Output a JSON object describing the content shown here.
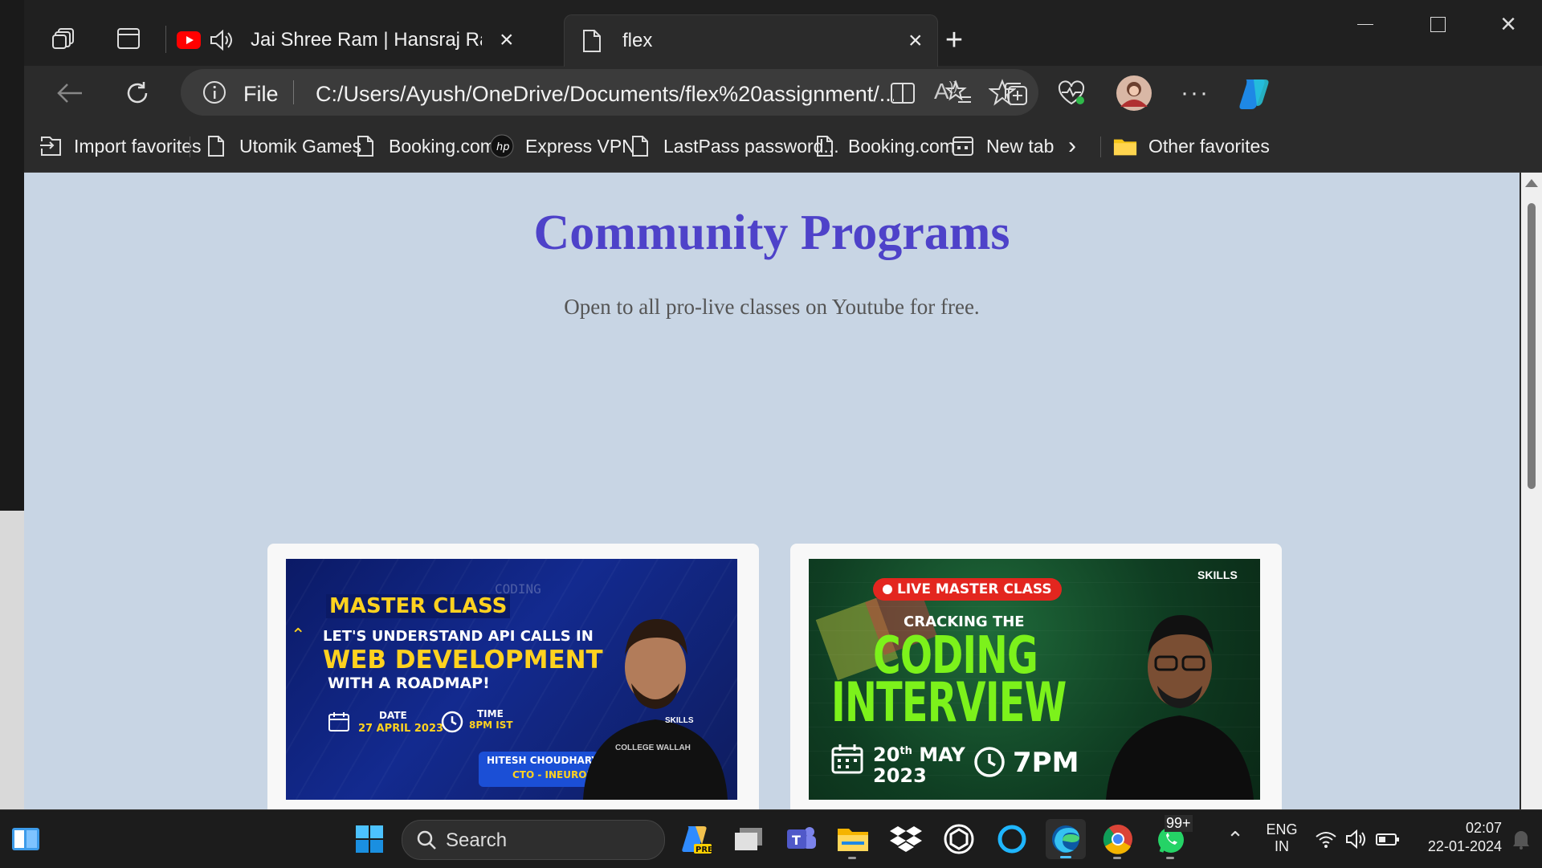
{
  "browser": {
    "tabs": [
      {
        "title": "Jai Shree Ram | Hansraj Raghuwanshi",
        "favicon": "youtube-icon",
        "audio": true,
        "active": false
      },
      {
        "title": "flex",
        "favicon": "file-icon",
        "active": true
      }
    ],
    "address": {
      "scheme_label": "File",
      "url": "C:/Users/Ayush/OneDrive/Documents/flex%20assignment/..."
    },
    "favorites": [
      {
        "label": "Import favorites",
        "icon": "import-icon"
      },
      {
        "label": "Utomik Games",
        "icon": "page-icon"
      },
      {
        "label": "Booking.com",
        "icon": "page-icon"
      },
      {
        "label": "Express VPN",
        "icon": "hp-icon"
      },
      {
        "label": "LastPass password...",
        "icon": "page-icon"
      },
      {
        "label": "Booking.com",
        "icon": "page-icon"
      },
      {
        "label": "New tab",
        "icon": "newtab-icon"
      }
    ],
    "other_favorites": "Other favorites"
  },
  "page": {
    "title": "Community Programs",
    "subtitle": "Open to all pro-live classes on Youtube for free.",
    "cards": [
      {
        "badge": "MASTER CLASS",
        "line1": "LET'S UNDERSTAND API CALLS IN",
        "headline": "WEB DEVELOPMENT",
        "line3": "WITH A ROADMAP!",
        "date_label": "DATE",
        "date": "27 APRIL 2023",
        "time_label": "TIME",
        "time": "8PM IST",
        "speaker": "HITESH CHOUDHARY",
        "role": "CTO - INEURON",
        "watermark": "CODING",
        "brand": "SKILLS",
        "shirt": "COLLEGE WALLAH"
      },
      {
        "badge": "LIVE MASTER CLASS",
        "line1": "CRACKING THE",
        "headline1": "CODING",
        "headline2": "INTERVIEW",
        "date_day": "20",
        "date_sup": "th",
        "date_month": "MAY",
        "date_year": "2023",
        "time": "7PM",
        "brand": "SKILLS"
      }
    ]
  },
  "taskbar": {
    "search_placeholder": "Search",
    "whatsapp_badge": "99+",
    "lang_line1": "ENG",
    "lang_line2": "IN",
    "time": "02:07",
    "date": "22-01-2024"
  },
  "colors": {
    "page_bg": "#c8d5e4",
    "title": "#4e42c9",
    "subtitle": "#555555"
  }
}
